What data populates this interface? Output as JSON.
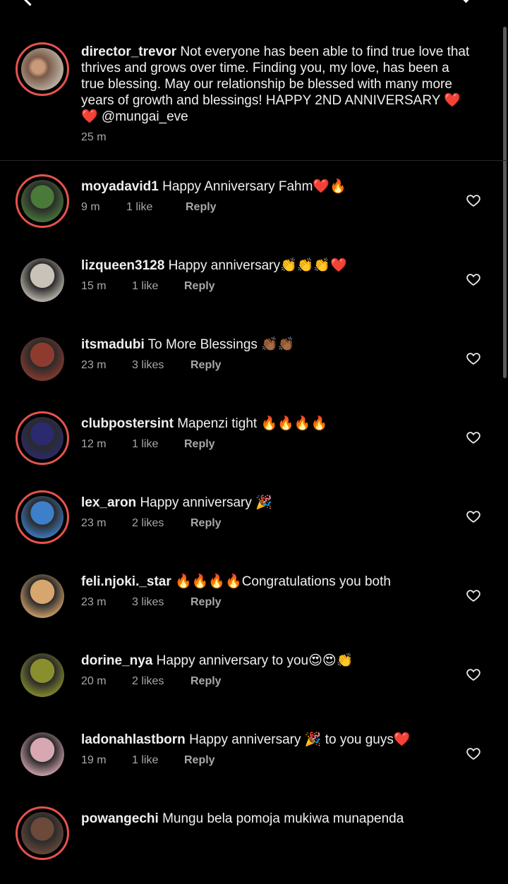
{
  "caption": {
    "username": "director_trevor",
    "text": "Not everyone has been able to find true love that thrives and grows over time. Finding you, my love, has been a true blessing. May our relationship be blessed with many more years of growth and blessings! HAPPY 2ND ANNIVERSARY ❤️ ❤️ @mungai_eve",
    "time": "25 m"
  },
  "reply_label": "Reply",
  "comments": [
    {
      "username": "moyadavid1",
      "text": "Happy Anniversary Fahm❤️🔥",
      "time": "9 m",
      "likes": "1 like",
      "avatar_color": "#4a7a3a",
      "ring": true
    },
    {
      "username": "lizqueen3128",
      "text": "Happy anniversary👏👏👏❤️",
      "time": "15 m",
      "likes": "1 like",
      "avatar_color": "#c9c2b8",
      "ring": false
    },
    {
      "username": "itsmadubi",
      "text": "To More Blessings 👏🏾👏🏾",
      "time": "23 m",
      "likes": "3 likes",
      "avatar_color": "#8d3b2f",
      "ring": false
    },
    {
      "username": "clubpostersint",
      "text": "Mapenzi tight 🔥🔥🔥🔥",
      "time": "12 m",
      "likes": "1 like",
      "avatar_color": "#2b2a6e",
      "ring": true
    },
    {
      "username": "lex_aron",
      "text": "Happy anniversary 🎉",
      "time": "23 m",
      "likes": "2 likes",
      "avatar_color": "#3d7fc9",
      "ring": true
    },
    {
      "username": "feli.njoki._star",
      "text": "🔥🔥🔥🔥Congratulations you both",
      "time": "23 m",
      "likes": "3 likes",
      "avatar_color": "#d6a66e",
      "ring": false
    },
    {
      "username": "dorine_nya",
      "text": "Happy anniversary to you😍😍👏",
      "time": "20 m",
      "likes": "2 likes",
      "avatar_color": "#8a8f2e",
      "ring": false
    },
    {
      "username": "ladonahlastborn",
      "text": "Happy anniversary 🎉 to you guys❤️",
      "time": "19 m",
      "likes": "1 like",
      "avatar_color": "#d7a7b2",
      "ring": false
    },
    {
      "username": "powangechi",
      "text": "Mungu bela pomoja mukiwa munapenda",
      "time": "",
      "likes": "",
      "avatar_color": "#6b4a3a",
      "ring": true
    }
  ],
  "colors": {
    "ring": "#e4534d",
    "muted": "#a8a8a8",
    "background": "#000000"
  }
}
